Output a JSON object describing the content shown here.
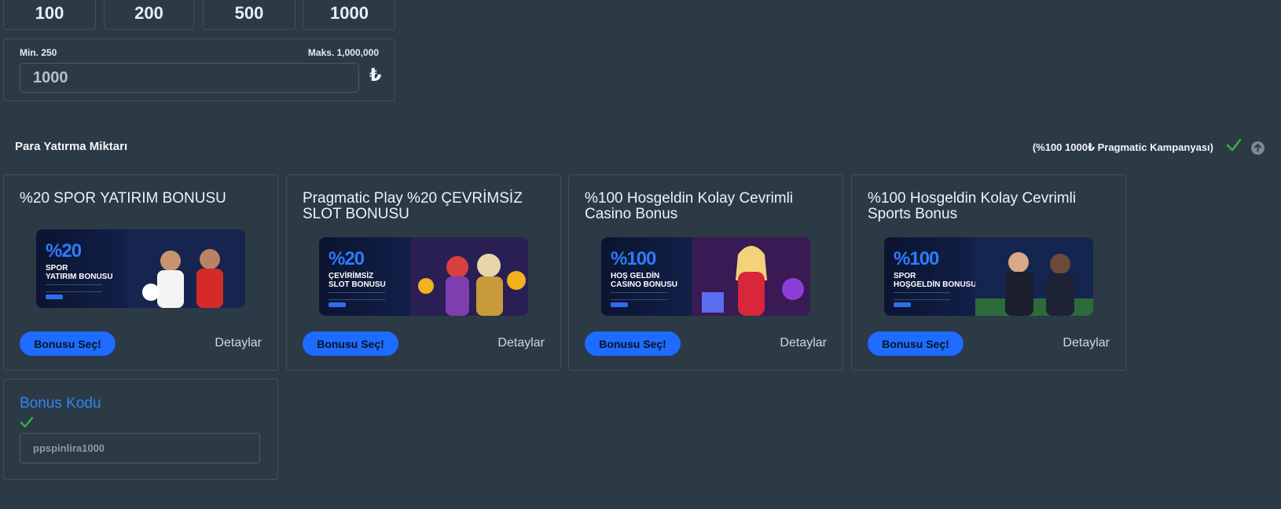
{
  "quick_amounts": [
    "100",
    "200",
    "500",
    "1000"
  ],
  "amount": {
    "min_label": "Min. 250",
    "max_label": "Maks. 1,000,000",
    "value": "1000",
    "currency_symbol": "₺"
  },
  "section": {
    "title": "Para Yatırma Miktarı",
    "campaign": "(%100 1000₺ Pragmatic Kampanyası)"
  },
  "cards": [
    {
      "title": "%20 SPOR YATIRIM BONUSU",
      "select": "Bonusu Seç!",
      "details": "Detaylar",
      "banner_big": "%20",
      "banner_sub": "SPOR\nYATIRIM BONUSU"
    },
    {
      "title": "Pragmatic Play %20 ÇEVRİMSİZ SLOT BONUSU",
      "select": "Bonusu Seç!",
      "details": "Detaylar",
      "banner_big": "%20",
      "banner_sub": "ÇEVİRİMSİZ\nSLOT BONUSU"
    },
    {
      "title": "%100 Hosgeldin Kolay Cevrimli Casino Bonus",
      "select": "Bonusu Seç!",
      "details": "Detaylar",
      "banner_big": "%100",
      "banner_sub": "HOŞ GELDİN\nCASINO BONUSU"
    },
    {
      "title": "%100 Hosgeldin Kolay Cevrimli Sports Bonus",
      "select": "Bonusu Seç!",
      "details": "Detaylar",
      "banner_big": "%100",
      "banner_sub": "SPOR\nHOŞGELDİN BONUSU"
    }
  ],
  "bonus_code": {
    "title": "Bonus Kodu",
    "value": "ppspinlira1000"
  },
  "colors": {
    "background": "#2c3a45",
    "accent": "#1e6bff",
    "success": "#2fb24a"
  }
}
